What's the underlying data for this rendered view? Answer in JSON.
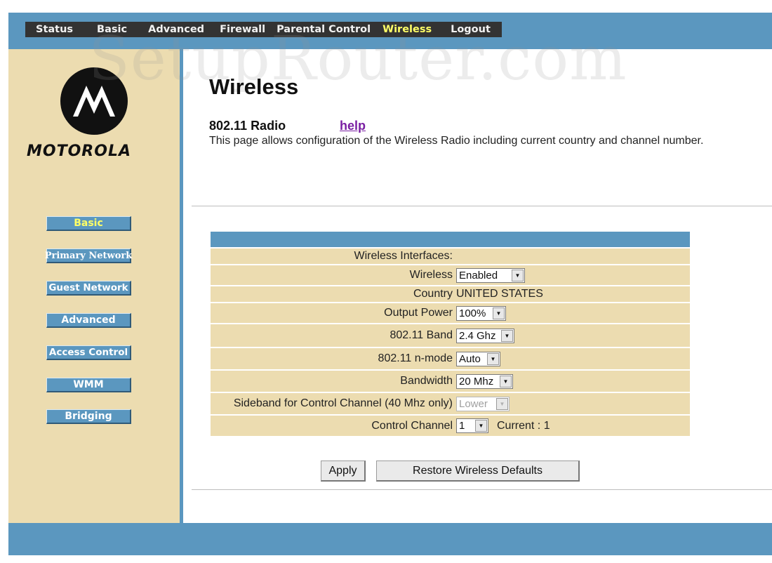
{
  "topnav": {
    "tabs": [
      {
        "label": "Status",
        "active": false
      },
      {
        "label": "Basic",
        "active": false
      },
      {
        "label": "Advanced",
        "active": false
      },
      {
        "label": "Firewall",
        "active": false
      },
      {
        "label": "Parental Control",
        "active": false
      },
      {
        "label": "Wireless",
        "active": true
      },
      {
        "label": "Logout",
        "active": false
      }
    ]
  },
  "brand": {
    "name": "MOTOROLA",
    "watermark": "SetupRouter.com"
  },
  "sidebar": {
    "items": [
      {
        "label": "Basic",
        "active": true
      },
      {
        "label": "Primary Network",
        "active": false
      },
      {
        "label": "Guest Network",
        "active": false
      },
      {
        "label": "Advanced",
        "active": false
      },
      {
        "label": "Access Control",
        "active": false
      },
      {
        "label": "WMM",
        "active": false
      },
      {
        "label": "Bridging",
        "active": false
      }
    ]
  },
  "page": {
    "title": "Wireless",
    "section_title": "802.11 Radio",
    "help_link": "help",
    "description": "This page allows configuration of the Wireless Radio including current country and channel number."
  },
  "form": {
    "interfaces_label": "Wireless Interfaces:",
    "wireless": {
      "label": "Wireless",
      "value": "Enabled"
    },
    "country": {
      "label": "Country",
      "value": "UNITED STATES"
    },
    "output_power": {
      "label": "Output Power",
      "value": "100%"
    },
    "band": {
      "label": "802.11 Band",
      "value": "2.4 Ghz"
    },
    "nmode": {
      "label": "802.11 n-mode",
      "value": "Auto"
    },
    "bandwidth": {
      "label": "Bandwidth",
      "value": "20 Mhz"
    },
    "sideband": {
      "label": "Sideband for Control Channel (40 Mhz only)",
      "value": "Lower"
    },
    "control_channel": {
      "label": "Control Channel",
      "value": "1",
      "current": "Current : 1"
    }
  },
  "buttons": {
    "apply": "Apply",
    "restore": "Restore Wireless Defaults"
  },
  "colors": {
    "band_blue": "#5b97bf",
    "sidebar_tan": "#ecdcb0",
    "nav_dark": "#333333",
    "active_yellow": "#ffff66",
    "link_purple": "#7a1fa3"
  }
}
